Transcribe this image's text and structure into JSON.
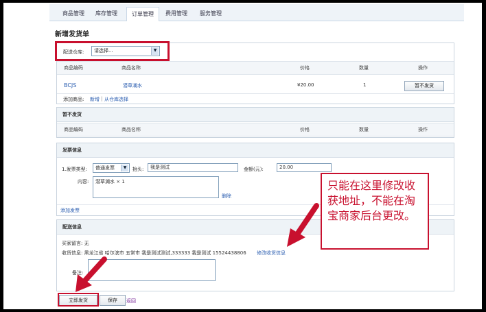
{
  "nav": {
    "tabs": [
      "商品管理",
      "库存管理",
      "订单管理",
      "费用管理",
      "服务管理"
    ],
    "active": 2
  },
  "page_title": "新增发货单",
  "warehouse": {
    "label": "配送仓库:",
    "selected": "请选择..."
  },
  "goods_table": {
    "headers": [
      "商品编码",
      "商品名称",
      "价格",
      "数量",
      "操作"
    ],
    "row": {
      "code": "BCJS",
      "name": "潜草澜水",
      "price": "¥20.00",
      "qty": "1",
      "action": "暂不发货"
    },
    "add_label": "添加商品:",
    "add_new": "新增",
    "add_from": "从仓库选择"
  },
  "hold_section": {
    "title": "暂不发货",
    "headers": [
      "商品编码",
      "商品名称",
      "价格",
      "数量",
      "操作"
    ]
  },
  "invoice_section": {
    "title": "发票信息",
    "type_label": "1.发票类型:",
    "type_value": "普通发票",
    "header_label": "抬头:",
    "header_value": "我是测试",
    "amount_label": "金额(元):",
    "amount_value": "20.00",
    "content_label": "内容:",
    "content_value": "潜草澜水 × 1",
    "delete_label": "删除",
    "add_invoice": "添加发票"
  },
  "delivery_section": {
    "title": "配送信息",
    "buyer_msg": "买家留言: 无",
    "address": "收货信息: 黑龙江省 哈尔滨市 五常市 我是测试测试,333333 我是测试 15524438806",
    "edit_address": "修改收货信息",
    "remark_label": "备注:"
  },
  "buttons": {
    "submit": "立即发货",
    "save": "保存",
    "back": "返回"
  },
  "callout_text": "只能在这里修改收获地址，不能在淘宝商家后台更改。",
  "colors": {
    "highlight": "#c8102e",
    "link": "#2a5db0"
  }
}
